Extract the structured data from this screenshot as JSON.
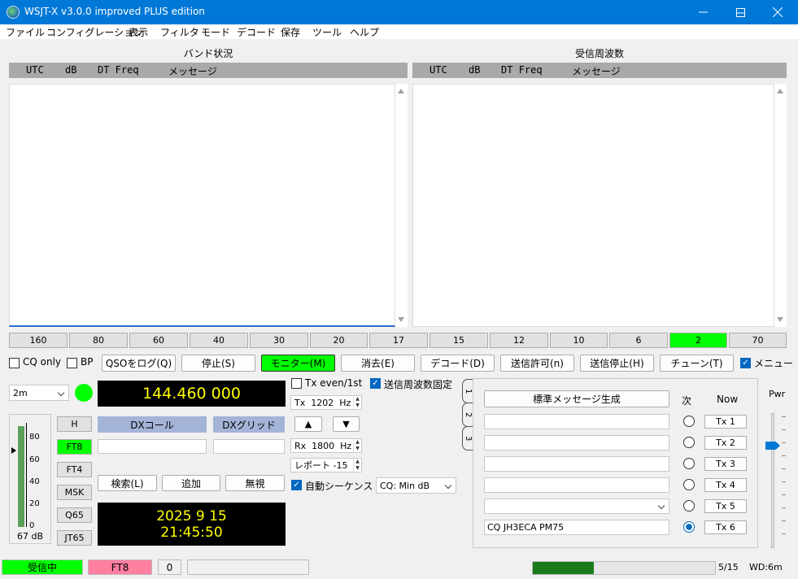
{
  "window": {
    "title": "WSJT-X   v3.0.0  improved PLUS edition",
    "minimize": "—",
    "maximize": "☐",
    "close": "✕"
  },
  "menu": [
    "ファイル",
    "コンフィグレーション",
    "表示",
    "フィルタ",
    "モード",
    "デコード",
    "保存",
    "ツール",
    "ヘルプ"
  ],
  "band_activity": {
    "title": "バンド状況",
    "columns": [
      "UTC",
      "dB",
      "DT Freq",
      "メッセージ"
    ]
  },
  "rx_frequency": {
    "title": "受信周波数",
    "columns": [
      "UTC",
      "dB",
      "DT Freq",
      "メッセージ"
    ]
  },
  "bands": [
    "160",
    "80",
    "60",
    "40",
    "30",
    "20",
    "17",
    "15",
    "12",
    "10",
    "6",
    "2",
    "70"
  ],
  "active_band": "2",
  "controls": {
    "cq_only": "CQ only",
    "bp": "BP",
    "log_qso": "QSOをログ(Q)",
    "stop": "停止(S)",
    "monitor": "モニター(M)",
    "erase": "消去(E)",
    "decode": "デコード(D)",
    "enable_tx": "送信許可(n)",
    "halt_tx": "送信停止(H)",
    "tune": "チューン(T)",
    "menus": "メニュー"
  },
  "band_select": "2m",
  "frequency": "144.460 000",
  "modes": [
    "H",
    "FT8",
    "FT4",
    "MSK",
    "Q65",
    "JT65"
  ],
  "active_mode": "FT8",
  "dx_call_label": "DXコール",
  "dx_grid_label": "DXグリッド",
  "lookup": "検索(L)",
  "add": "追加",
  "ignore": "無視",
  "date": "2025 9 15",
  "time": "21:45:50",
  "meter": {
    "ticks": [
      "80",
      "60",
      "40",
      "20",
      "0"
    ],
    "level_db": "67 dB"
  },
  "tx_even": "Tx even/1st",
  "hold_tx_freq": "送信周波数固定",
  "tx_freq": {
    "label": "Tx",
    "value": "1202",
    "unit": "Hz"
  },
  "rx_freq": {
    "label": "Rx",
    "value": "1800",
    "unit": "Hz"
  },
  "report": "レポート -15",
  "auto_seq": "自動シーケンス",
  "cq_select": "CQ: Min dB",
  "tabs": [
    "1",
    "2",
    "3"
  ],
  "gen_std_msgs": "標準メッセージ生成",
  "next_label": "次",
  "now_label": "Now",
  "tx_buttons": [
    "Tx 1",
    "Tx 2",
    "Tx 3",
    "Tx 4",
    "Tx 5",
    "Tx 6"
  ],
  "tx6_message": "CQ JH3ECA PM75",
  "pwr_label": "Pwr",
  "status": {
    "receiving": "受信中",
    "mode": "FT8",
    "count": "0",
    "tx_progress": "5/15",
    "wd": "WD:6m"
  },
  "colors": {
    "titlebar": "#0078d7",
    "active_green": "#00ff00",
    "mode_pink": "#ff7fa0",
    "lcd_text": "#ffff00",
    "progress": "#1a7a1a"
  }
}
